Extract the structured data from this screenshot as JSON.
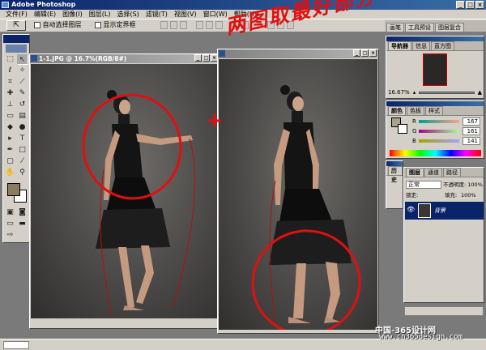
{
  "app": {
    "title": "Adobe Photoshop"
  },
  "window_controls": {
    "minimize": "_",
    "maximize": "□",
    "close": "×"
  },
  "menu": [
    "文件(F)",
    "编辑(E)",
    "图像(I)",
    "图层(L)",
    "选择(S)",
    "滤镜(T)",
    "视图(V)",
    "窗口(W)",
    "帮助(H)"
  ],
  "options": {
    "auto_select_label": "自动选择图层",
    "show_bounds_label": "显示定界框"
  },
  "palette_well": [
    "画笔",
    "工具预设",
    "图层复合"
  ],
  "doc1": {
    "title": "1-1.JPG @ 16.7%(RGB/8#)"
  },
  "doc2": {
    "title": ""
  },
  "navigator": {
    "tabs": [
      "导航器",
      "信息",
      "直方图"
    ],
    "zoom": "16.67%"
  },
  "color": {
    "tabs": [
      "颜色",
      "色板",
      "样式"
    ],
    "r_label": "R",
    "g_label": "G",
    "b_label": "B",
    "r": "167",
    "g": "161",
    "b": "141",
    "r_fraction": 0.655,
    "g_fraction": 0.631,
    "b_fraction": 0.553,
    "foreground": "#a7a18d"
  },
  "history": {
    "tabs": [
      "历史"
    ]
  },
  "layers": {
    "tabs": [
      "图层",
      "通道",
      "路径"
    ],
    "blend_mode": "正常",
    "opacity_label": "不透明度:",
    "opacity": "100%",
    "lock_label": "锁定:",
    "fill_label": "填充:",
    "fill": "100%",
    "layer_name": "背景"
  },
  "annotations": {
    "title": "两图取最好部分",
    "plus": "+"
  },
  "watermark": {
    "cn": "中国-365设计网",
    "url": "www.cn365design.com"
  }
}
